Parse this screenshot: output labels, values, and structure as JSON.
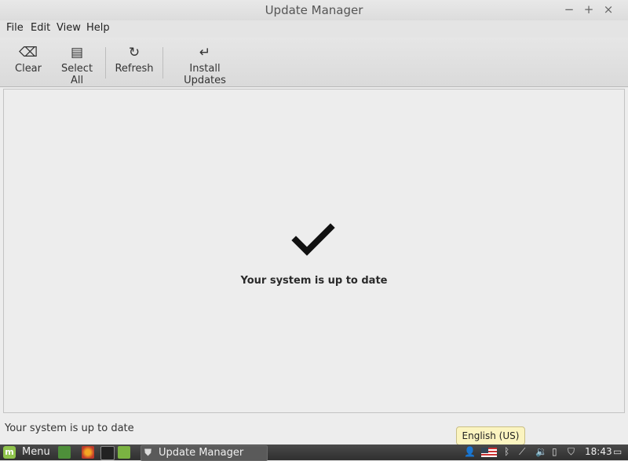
{
  "window": {
    "title": "Update Manager",
    "controls": {
      "minimize": "−",
      "maximize": "+",
      "close": "×"
    }
  },
  "menubar": {
    "items": [
      {
        "label": "File"
      },
      {
        "label": "Edit"
      },
      {
        "label": "View"
      },
      {
        "label": "Help"
      }
    ]
  },
  "toolbar": {
    "buttons": [
      {
        "label": "Clear",
        "icon": "clear-icon",
        "glyph": "⌫"
      },
      {
        "label": "Select All",
        "icon": "select-all-icon",
        "glyph": "▤"
      },
      {
        "label": "Refresh",
        "icon": "refresh-icon",
        "glyph": "↻"
      },
      {
        "label": "Install Updates",
        "icon": "install-icon",
        "glyph": "↵"
      }
    ]
  },
  "main": {
    "message": "Your system is up to date",
    "icon": "checkmark-icon"
  },
  "statusbar": {
    "text": "Your system is up to date"
  },
  "tooltip": {
    "text": "English (US)"
  },
  "panel": {
    "menu_label": "Menu",
    "task_label": "Update Manager",
    "clock": "18:43",
    "tray_icons": [
      "user-icon",
      "keyboard-layout-flag-icon",
      "bluetooth-icon",
      "volume-icon",
      "network-icon",
      "battery-icon",
      "update-shield-icon",
      "workspace-icon"
    ]
  },
  "colors": {
    "mint_green": "#8fc34b",
    "panel_bg": "#3a3a3a",
    "window_bg": "#ededed",
    "tooltip_bg": "#fbf4c0"
  }
}
